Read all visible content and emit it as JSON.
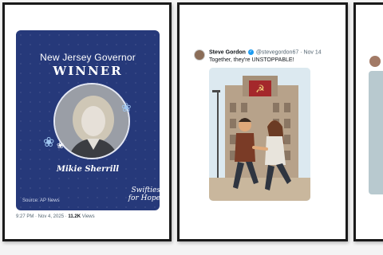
{
  "card1": {
    "graphic": {
      "title": "New Jersey Governor",
      "winner": "WINNER",
      "name": "Mikie Sherrill",
      "credit": "Source: AP News",
      "logo": [
        "Swifties",
        "for Hope"
      ]
    },
    "timestamp": "9:27 PM · Nov 4, 2025 ·",
    "views_count": "11.2K",
    "views_label": "Views"
  },
  "card2": {
    "author_name": "Steve Gordon",
    "handle_date": "@stevegordon67 · Nov 14",
    "text": "Together, they're UNSTOPPABLE!"
  },
  "colors": {
    "graphic_bg": "#26397a",
    "verified": "#1d9bf0",
    "card_border": "#1a1a1a"
  },
  "icons": {
    "verified": "verified-badge-icon",
    "butterfly": "butterfly-icon"
  }
}
